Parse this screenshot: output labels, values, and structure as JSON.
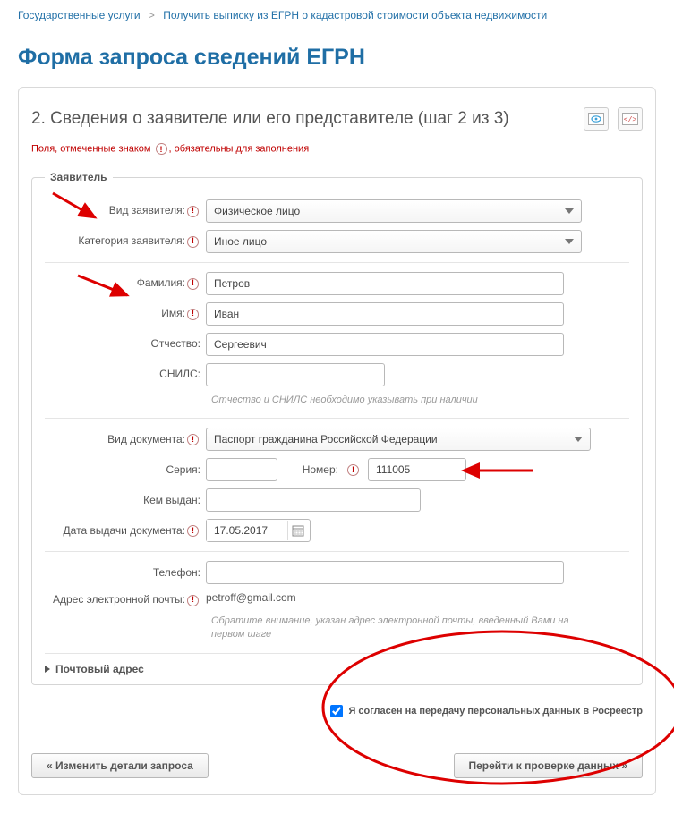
{
  "breadcrumb": {
    "root": "Государственные услуги",
    "sep": ">",
    "current": "Получить выписку из ЕГРН о кадастровой стоимости объекта недвижимости"
  },
  "title": "Форма запроса сведений ЕГРН",
  "step_title": "2. Сведения о заявителе или его представителе (шаг 2 из 3)",
  "required_note_a": "Поля, отмеченные знаком",
  "required_note_b": ", обязательны для заполнения",
  "fieldset_legend": "Заявитель",
  "labels": {
    "kind": "Вид заявителя:",
    "category": "Категория заявителя:",
    "surname": "Фамилия:",
    "name": "Имя:",
    "patronymic": "Отчество:",
    "snils": "СНИЛС:",
    "doc_kind": "Вид документа:",
    "series": "Серия:",
    "number": "Номер:",
    "issued_by": "Кем выдан:",
    "issue_date": "Дата выдачи документа:",
    "phone": "Телефон:",
    "email": "Адрес электронной почты:"
  },
  "values": {
    "kind": "Физическое лицо",
    "category": "Иное лицо",
    "surname": "Петров",
    "name": "Иван",
    "patronymic": "Сергеевич",
    "snils": "",
    "doc_kind": "Паспорт гражданина Российской Федерации",
    "series": "",
    "number": "111005",
    "issued_by": "",
    "issue_date": "17.05.2017",
    "phone": "",
    "email": "petroff@gmail.com"
  },
  "hints": {
    "patronymic_snils": "Отчество и СНИЛС необходимо указывать при наличии",
    "email": "Обратите внимание, указан адрес электронной почты, введенный Вами на первом шаге"
  },
  "expander": "Почтовый адрес",
  "consent": "Я согласен на передачу персональных данных в Росреестр",
  "buttons": {
    "back": "Изменить детали запроса",
    "next": "Перейти к проверке данных"
  },
  "quote_left": "«",
  "quote_right": "»",
  "bang": "!"
}
